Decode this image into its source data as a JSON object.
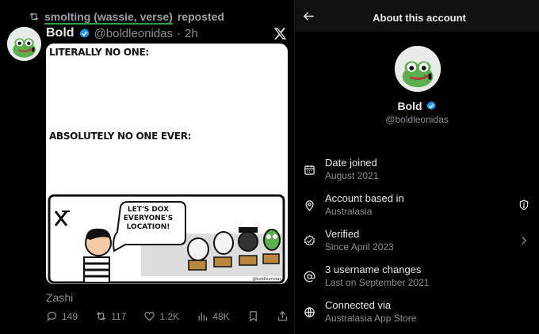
{
  "tweet": {
    "repost_user": "smolting (wassie, verse)",
    "repost_suffix": "reposted",
    "author_name": "Bold",
    "author_handle": "@boldleonidas",
    "separator": "·",
    "time": "2h",
    "comic": {
      "line1": "LITERALLY NO ONE:",
      "line2": "ABSOLUTELY NO ONE EVER:",
      "speech_line1": "LET'S DOX",
      "speech_line2": "EVERYONE'S",
      "speech_line3": "LOCATION!",
      "signature": "@boldleonidas"
    },
    "caption": "Zashi",
    "stats": {
      "replies": "149",
      "reposts": "117",
      "likes": "1.2K",
      "views": "48K"
    }
  },
  "about": {
    "title": "About this account",
    "name": "Bold",
    "handle": "@boldleonidas",
    "rows": [
      {
        "label": "Date joined",
        "value": "August 2021",
        "icon": "calendar-icon"
      },
      {
        "label": "Account based in",
        "value": "Australasia",
        "icon": "location-pin-icon",
        "trailing": "info-shield-icon"
      },
      {
        "label": "Verified",
        "value": "Since April 2023",
        "icon": "verified-badge-icon",
        "trailing": "chevron-right-icon"
      },
      {
        "label": "3 username changes",
        "value": "Last on September 2021",
        "icon": "at-icon"
      },
      {
        "label": "Connected via",
        "value": "Australasia App Store",
        "icon": "globe-icon"
      }
    ]
  },
  "colors": {
    "verified_blue": "#1d9bf0",
    "muted_text": "#8b8f94",
    "header_bg": "#111111",
    "repost_underline": "#2fa34a"
  }
}
